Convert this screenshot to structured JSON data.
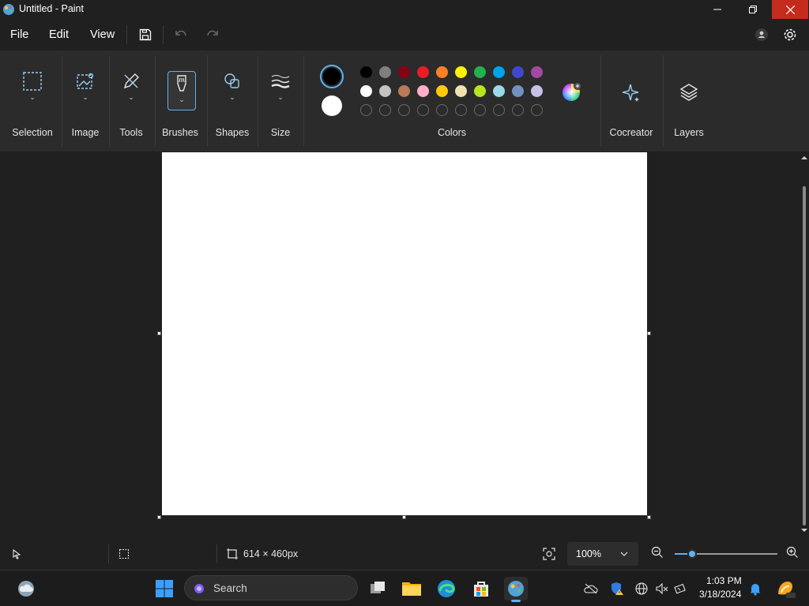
{
  "window": {
    "title": "Untitled - Paint"
  },
  "menu": {
    "file": "File",
    "edit": "Edit",
    "view": "View"
  },
  "ribbon": {
    "groups": {
      "selection": "Selection",
      "image": "Image",
      "tools": "Tools",
      "brushes": "Brushes",
      "shapes": "Shapes",
      "size": "Size",
      "colors": "Colors",
      "cocreator": "Cocreator",
      "layers": "Layers"
    },
    "primary_color": "#000000",
    "secondary_color": "#ffffff",
    "palette_row1": [
      "#000000",
      "#7f7f7f",
      "#880015",
      "#ed1c24",
      "#ff7f27",
      "#fff200",
      "#22b14c",
      "#00a2e8",
      "#3f48cc",
      "#a349a4"
    ],
    "palette_row2": [
      "#ffffff",
      "#c3c3c3",
      "#b97a57",
      "#ffaec9",
      "#ffc90e",
      "#efe4b0",
      "#b5e61d",
      "#99d9ea",
      "#7092be",
      "#c8bfe7"
    ]
  },
  "status": {
    "canvas_size": "614 × 460px",
    "zoom": "100%",
    "zoom_slider_fraction": 0.17
  },
  "taskbar": {
    "search_placeholder": "Search",
    "time": "1:03 PM",
    "date": "3/18/2024"
  }
}
